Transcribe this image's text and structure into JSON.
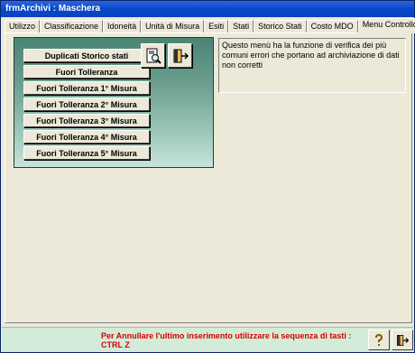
{
  "window": {
    "title": "frmArchivi : Maschera"
  },
  "tabs": [
    {
      "label": "Utilizzo"
    },
    {
      "label": "Classificazione"
    },
    {
      "label": "Idoneità"
    },
    {
      "label": "Unità di Misura"
    },
    {
      "label": "Esiti"
    },
    {
      "label": "Stati"
    },
    {
      "label": "Storico Stati"
    },
    {
      "label": "Costo MDO"
    },
    {
      "label": "Menu Controllo"
    }
  ],
  "active_tab": "Menu Controllo",
  "menu": {
    "buttons": [
      {
        "label": "Duplicati Storico stati"
      },
      {
        "label": "Fuori Tolleranza"
      },
      {
        "label": "Fuori Tolleranza  1° Misura"
      },
      {
        "label": "Fuori Tolleranza  2° Misura"
      },
      {
        "label": "Fuori Tolleranza  3° Misura"
      },
      {
        "label": "Fuori Tolleranza  4° Misura"
      },
      {
        "label": "Fuori Tolleranza  5° Misura"
      }
    ],
    "icons": {
      "preview": "print-preview-icon",
      "exit": "exit-door-icon"
    }
  },
  "info": {
    "text": "Questo menù ha la funzione di verifica dei più comuni errori che portano ad archiviazione di dati non corretti"
  },
  "status": {
    "message_line1": "Per Annullare l'ultimo inserimento utilizzare la sequenza di tasti :",
    "message_line2": "CTRL Z",
    "icons": {
      "help": "help-icon",
      "exit": "exit-door-icon"
    }
  },
  "colors": {
    "status_text": "#d40000",
    "panel_green": "#6b9e8f",
    "title_blue": "#0a4ad0"
  }
}
